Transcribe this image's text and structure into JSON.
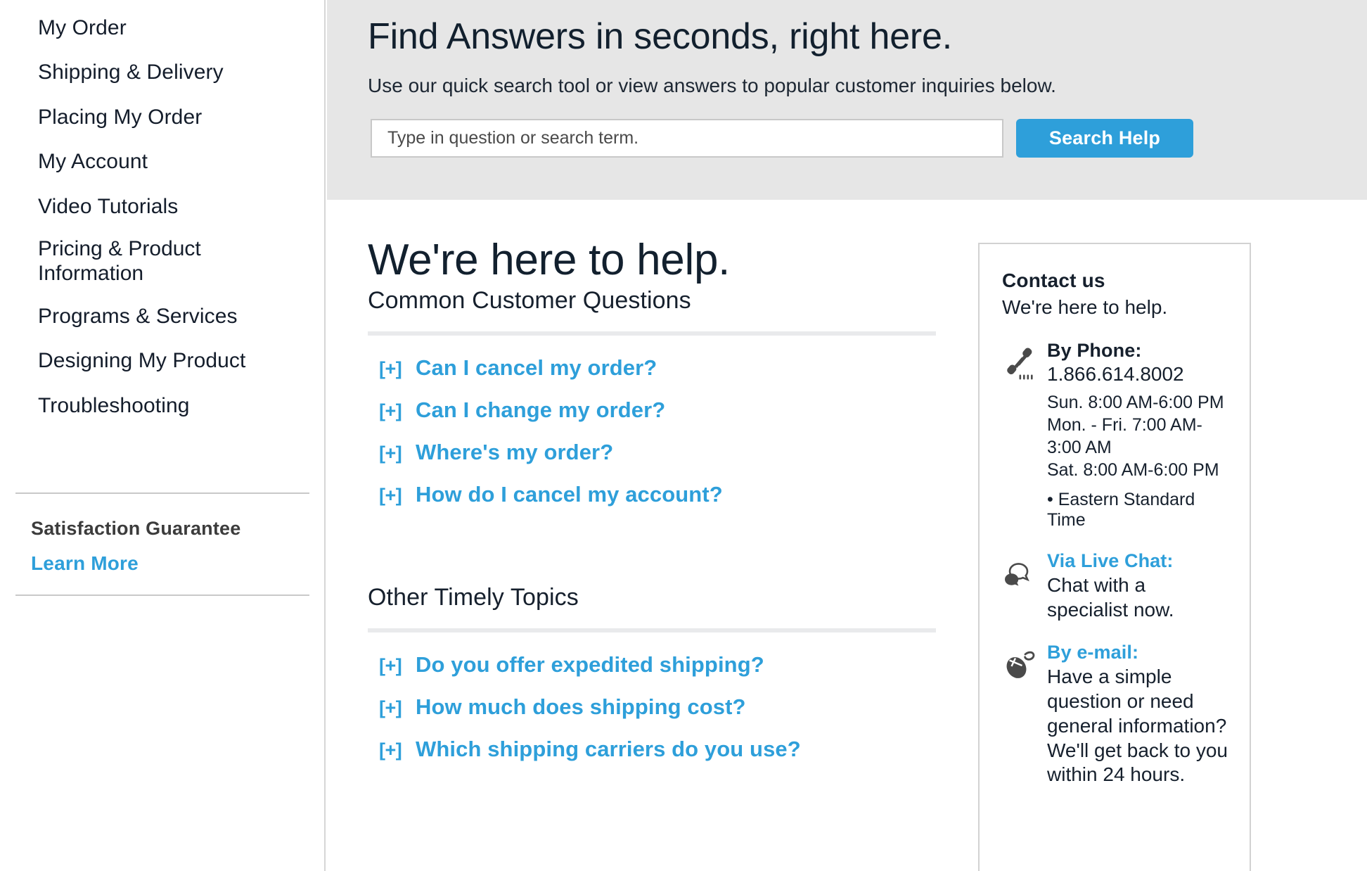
{
  "sidebar": {
    "nav_items": [
      "My Order",
      "Shipping & Delivery",
      "Placing My Order",
      "My Account",
      "Video Tutorials",
      "Pricing & Product Information",
      "Programs & Services",
      "Designing My Product",
      "Troubleshooting"
    ],
    "nav_item_pricing_line1": "Pricing & Product",
    "nav_item_pricing_line2": "Information",
    "guarantee": {
      "title": "Satisfaction Guarantee",
      "link": "Learn More"
    }
  },
  "search_header": {
    "title": "Find Answers in seconds, right here.",
    "subtitle": "Use our quick search tool or view answers to popular customer inquiries below.",
    "input_value": "",
    "placeholder": "Type in question or search term.",
    "button_label": "Search Help"
  },
  "main": {
    "page_title": "We're here to help.",
    "sections": [
      {
        "heading": "Common Customer Questions",
        "items": [
          {
            "marker": "[+]",
            "label": "Can I cancel my order?"
          },
          {
            "marker": "[+]",
            "label": "Can I change my order?"
          },
          {
            "marker": "[+]",
            "label": "Where's my order?"
          },
          {
            "marker": "[+]",
            "label": "How do I cancel my account?"
          }
        ]
      },
      {
        "heading": "Other Timely Topics",
        "items": [
          {
            "marker": "[+]",
            "label": "Do you offer expedited shipping?"
          },
          {
            "marker": "[+]",
            "label": "How much does shipping cost?"
          },
          {
            "marker": "[+]",
            "label": "Which shipping carriers do you use?"
          }
        ]
      }
    ]
  },
  "contact": {
    "title": "Contact us",
    "subtitle": "We're here to help.",
    "phone": {
      "icon": "telephone-icon",
      "label": "By Phone:",
      "number": "1.866.614.8002",
      "hours_sun": "Sun. 8:00 AM-6:00 PM",
      "hours_weekday": "Mon. - Fri. 7:00 AM-3:00 AM",
      "hours_sat": "Sat. 8:00 AM-6:00 PM",
      "timezone": "• Eastern Standard Time"
    },
    "chat": {
      "icon": "speech-bubbles-icon",
      "label": "Via Live Chat:",
      "text": "Chat with a specialist now."
    },
    "email": {
      "icon": "computer-mouse-icon",
      "label": "By e-mail:",
      "text": "Have a simple question or need general information? We'll get back to you within 24 hours."
    }
  },
  "colors": {
    "accent_blue": "#2e9fda",
    "header_gray": "#e6e6e6",
    "text_dark": "#16202d",
    "rule_gray": "#e9eaec",
    "border_gray": "#d2d2d2",
    "icon_gray": "#4a4a4a"
  }
}
